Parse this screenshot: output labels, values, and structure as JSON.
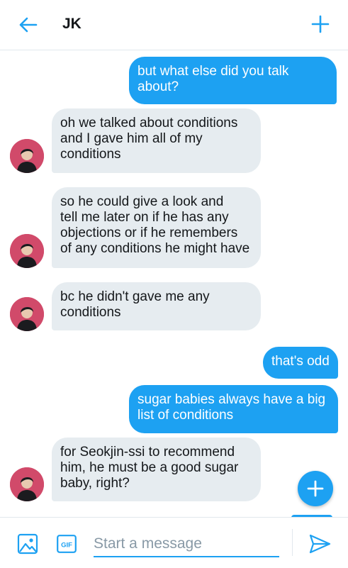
{
  "header": {
    "title": "JK",
    "back_icon": "arrow-left-icon",
    "add_icon": "plus-icon"
  },
  "messages": [
    {
      "direction": "outgoing",
      "text": "but what else did you talk\nabout?"
    },
    {
      "direction": "incoming",
      "text": "oh we talked about conditions\nand I gave him all of my\nconditions"
    },
    {
      "direction": "incoming",
      "text": "so he could give a look and\ntell me later on if he has any\nobjections or if he remembers\nof any conditions he might have"
    },
    {
      "direction": "incoming",
      "text": "bc he didn't gave me any\nconditions"
    },
    {
      "direction": "outgoing",
      "text": "that's odd"
    },
    {
      "direction": "outgoing",
      "text": "sugar babies always have a big\nlist of conditions"
    },
    {
      "direction": "incoming",
      "text": "for Seokjin-ssi to recommend\nhim, he must be a good sugar\nbaby, right?"
    }
  ],
  "composer": {
    "placeholder": "Start a message",
    "gif_label": "GIF",
    "image_icon": "image-icon",
    "send_icon": "send-icon"
  },
  "fab": {
    "icon": "plus-icon"
  },
  "colors": {
    "accent": "#1da1f2",
    "incoming_bubble": "#e6ecf0",
    "text": "#14171a",
    "avatar_bg": "#d14a6a"
  }
}
